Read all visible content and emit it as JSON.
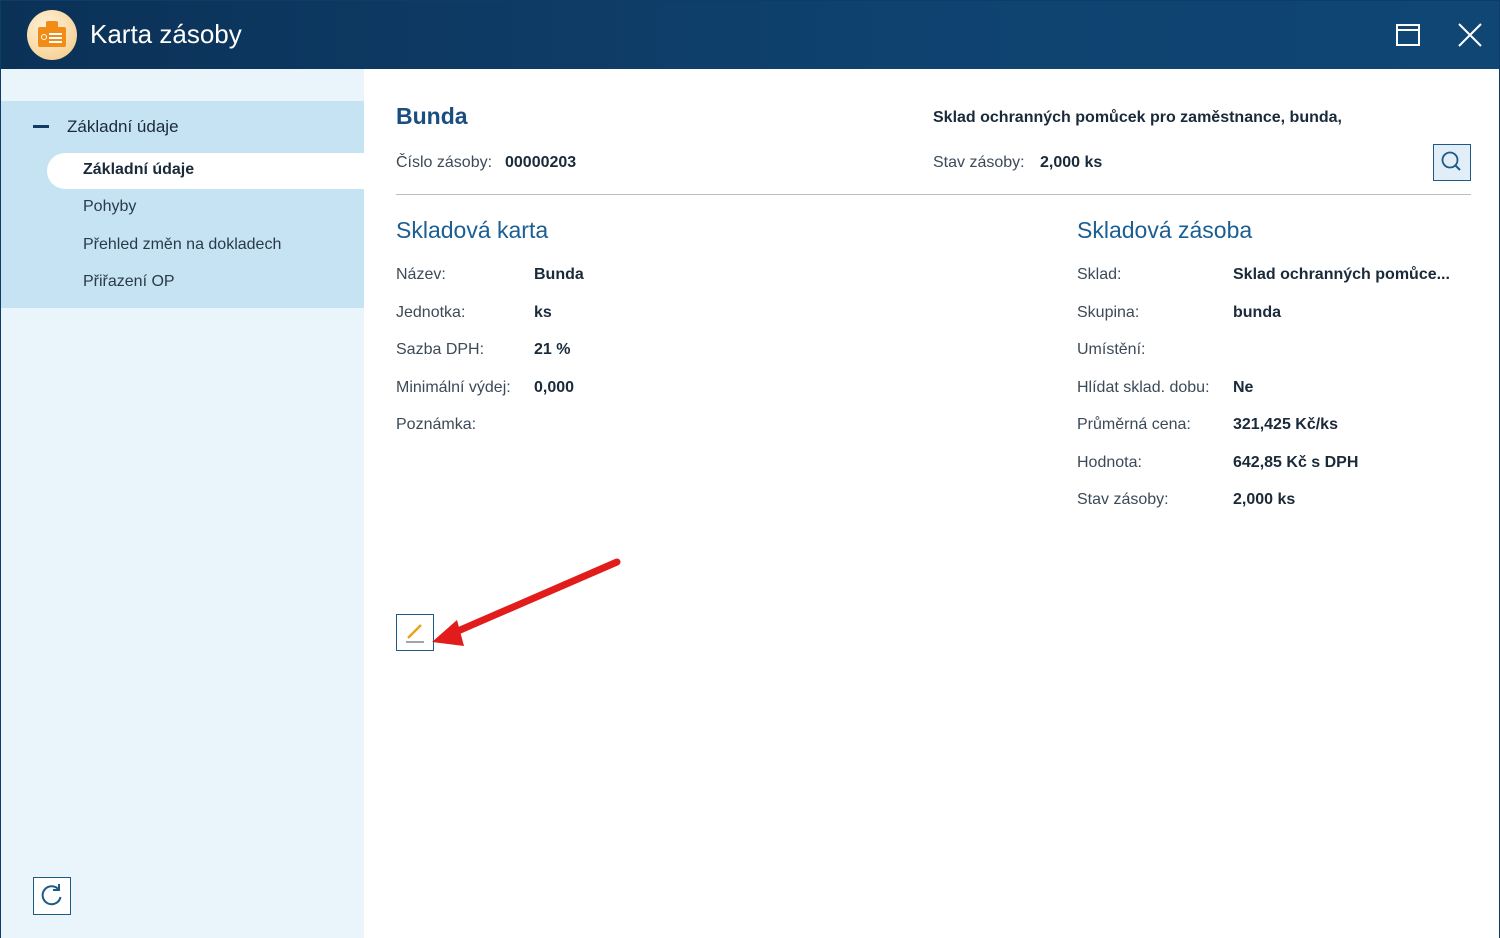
{
  "window": {
    "title": "Karta zásoby",
    "icons": {
      "app": "inventory-box-icon",
      "maximize": "maximize-icon",
      "close": "close-icon"
    }
  },
  "sidebar": {
    "group_label": "Základní údaje",
    "items": [
      {
        "label": "Základní údaje",
        "active": true
      },
      {
        "label": "Pohyby",
        "active": false
      },
      {
        "label": "Přehled změn na dokladech",
        "active": false
      },
      {
        "label": "Přiřazení OP",
        "active": false
      }
    ],
    "refresh_icon": "refresh-icon"
  },
  "header": {
    "item_name": "Bunda",
    "description": "Sklad ochranných pomůcek pro zaměstnance, bunda,",
    "number_label": "Číslo zásoby:",
    "number_value": "00000203",
    "stock_label": "Stav zásoby:",
    "stock_value": "2,000 ks",
    "search_icon": "search-icon"
  },
  "card": {
    "title": "Skladová karta",
    "fields": [
      {
        "label": "Název:",
        "value": "Bunda"
      },
      {
        "label": "Jednotka:",
        "value": "ks"
      },
      {
        "label": "Sazba DPH:",
        "value": "21 %"
      },
      {
        "label": "Minimální výdej:",
        "value": "0,000"
      },
      {
        "label": "Poznámka:",
        "value": ""
      }
    ]
  },
  "stock": {
    "title": "Skladová zásoba",
    "fields": [
      {
        "label": "Sklad:",
        "value": "Sklad ochranných pomůce..."
      },
      {
        "label": "Skupina:",
        "value": "bunda"
      },
      {
        "label": "Umístění:",
        "value": ""
      },
      {
        "label": "Hlídat sklad. dobu:",
        "value": "Ne"
      },
      {
        "label": "Průměrná cena:",
        "value": "321,425 Kč/ks"
      },
      {
        "label": "Hodnota:",
        "value": "642,85 Kč s DPH"
      },
      {
        "label": "Stav zásoby:",
        "value": "2,000 ks"
      }
    ]
  },
  "edit_icon": "pencil-edit-icon",
  "annotation": {
    "color": "#e21b1b"
  }
}
